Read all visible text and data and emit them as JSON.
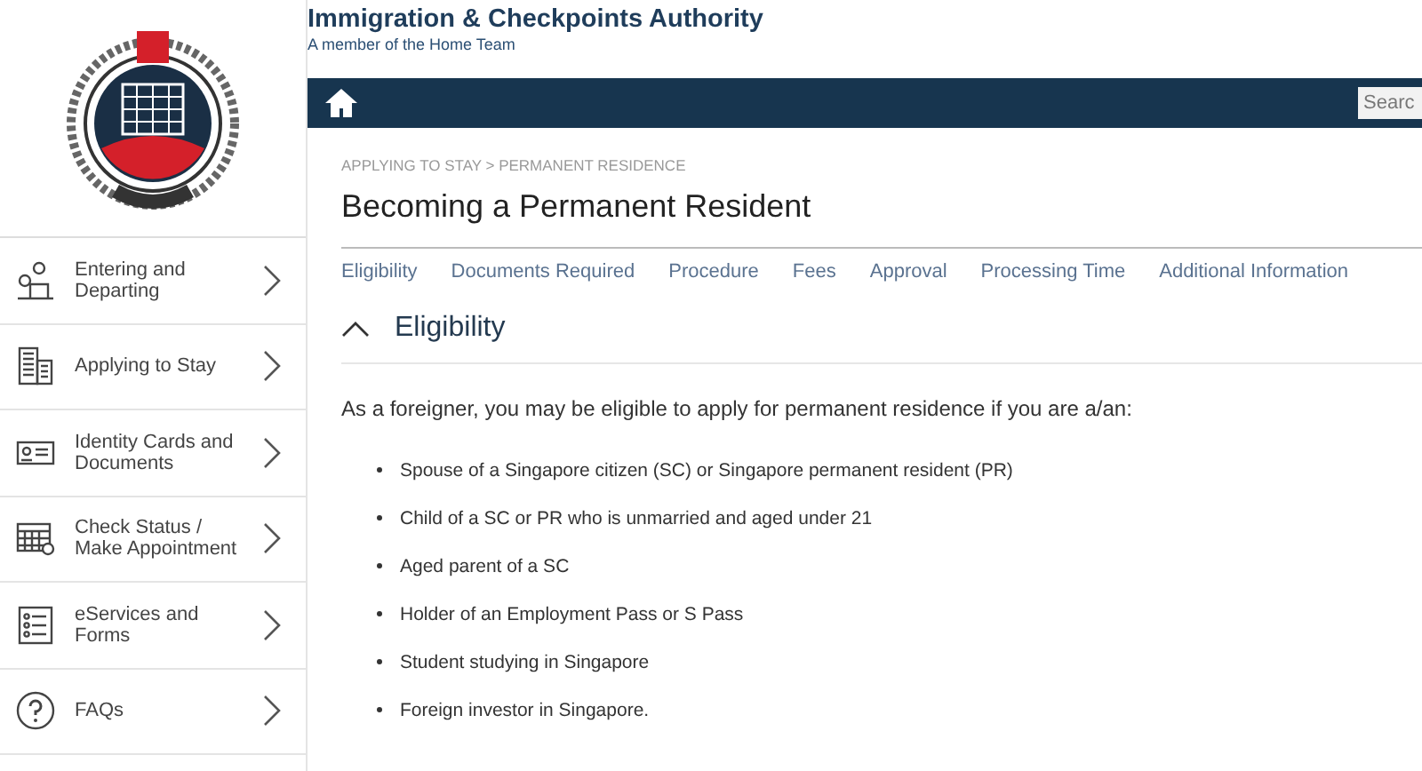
{
  "header": {
    "title": "Immigration & Checkpoints Authority",
    "subtitle": "A member of the Home Team"
  },
  "search": {
    "placeholder": "Searc"
  },
  "sidebar": {
    "items": [
      {
        "label": "Entering and Departing",
        "kind": "travel"
      },
      {
        "label": "Applying to Stay",
        "kind": "building"
      },
      {
        "label": "Identity Cards and Documents",
        "kind": "card"
      },
      {
        "label": "Check Status / Make Appointment",
        "kind": "calendar"
      },
      {
        "label": "eServices and Forms",
        "kind": "list"
      },
      {
        "label": "FAQs",
        "kind": "help"
      }
    ]
  },
  "breadcrumb": "APPLYING TO STAY > PERMANENT RESIDENCE",
  "page_title": "Becoming a Permanent Resident",
  "section_links": [
    "Eligibility",
    "Documents Required",
    "Procedure",
    "Fees",
    "Approval",
    "Processing Time",
    "Additional Information"
  ],
  "section": {
    "title": "Eligibility",
    "expanded": true,
    "intro": "As a foreigner, you may be eligible to apply for permanent residence if you are a/an:",
    "items": [
      "Spouse of a Singapore citizen (SC) or Singapore permanent resident (PR)",
      "Child of a SC or PR who is unmarried and aged under 21",
      "Aged parent of a SC",
      "Holder of an Employment Pass or S Pass",
      "Student studying in Singapore",
      "Foreign investor in Singapore."
    ]
  }
}
